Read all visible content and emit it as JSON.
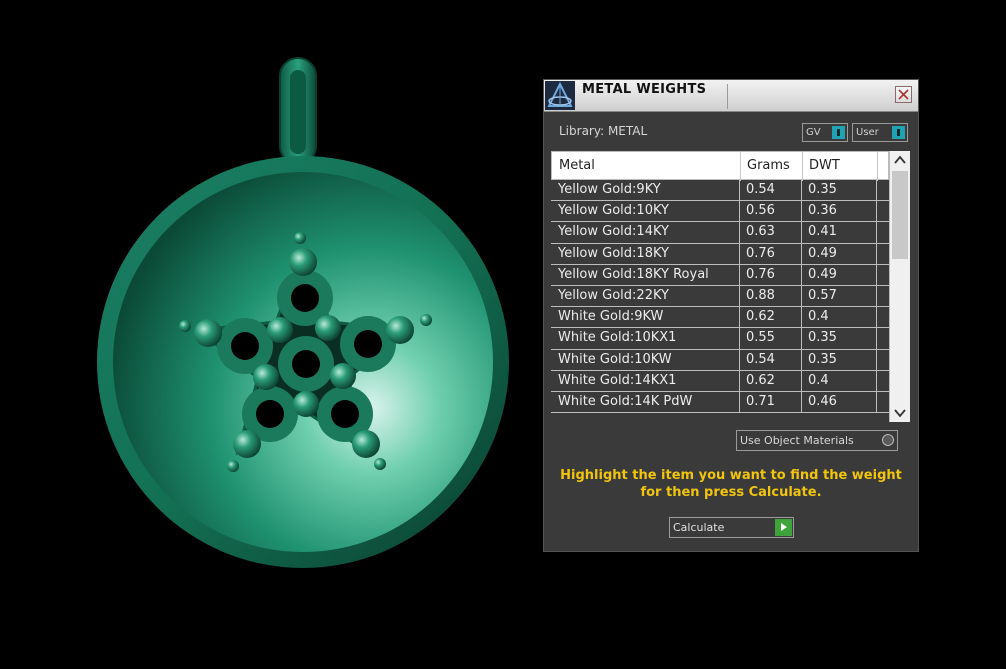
{
  "panel": {
    "title": "METAL WEIGHTS",
    "library_label": "Library: METAL",
    "toggle_gv": "GV",
    "toggle_user": "User",
    "columns": [
      "Metal",
      "Grams",
      "DWT"
    ],
    "rows": [
      [
        "Yellow Gold:9KY",
        "0.54",
        "0.35"
      ],
      [
        "Yellow Gold:10KY",
        "0.56",
        "0.36"
      ],
      [
        "Yellow Gold:14KY",
        "0.63",
        "0.41"
      ],
      [
        "Yellow Gold:18KY",
        "0.76",
        "0.49"
      ],
      [
        "Yellow Gold:18KY Royal",
        "0.76",
        "0.49"
      ],
      [
        "Yellow Gold:22KY",
        "0.88",
        "0.57"
      ],
      [
        "White Gold:9KW",
        "0.62",
        "0.4"
      ],
      [
        "White Gold:10KX1",
        "0.55",
        "0.35"
      ],
      [
        "White Gold:10KW",
        "0.54",
        "0.35"
      ],
      [
        "White Gold:14KX1",
        "0.62",
        "0.4"
      ],
      [
        "White Gold:14K PdW",
        "0.71",
        "0.46"
      ]
    ],
    "use_object_materials": "Use Object Materials",
    "hint": "Highlight the item you want to find the weight for then press Calculate.",
    "calculate": "Calculate"
  },
  "colors": {
    "accent": "#1fa3b3",
    "hint": "#f1c40f",
    "calculate_button": "#3da33a",
    "pendant": "#1e8a66"
  }
}
